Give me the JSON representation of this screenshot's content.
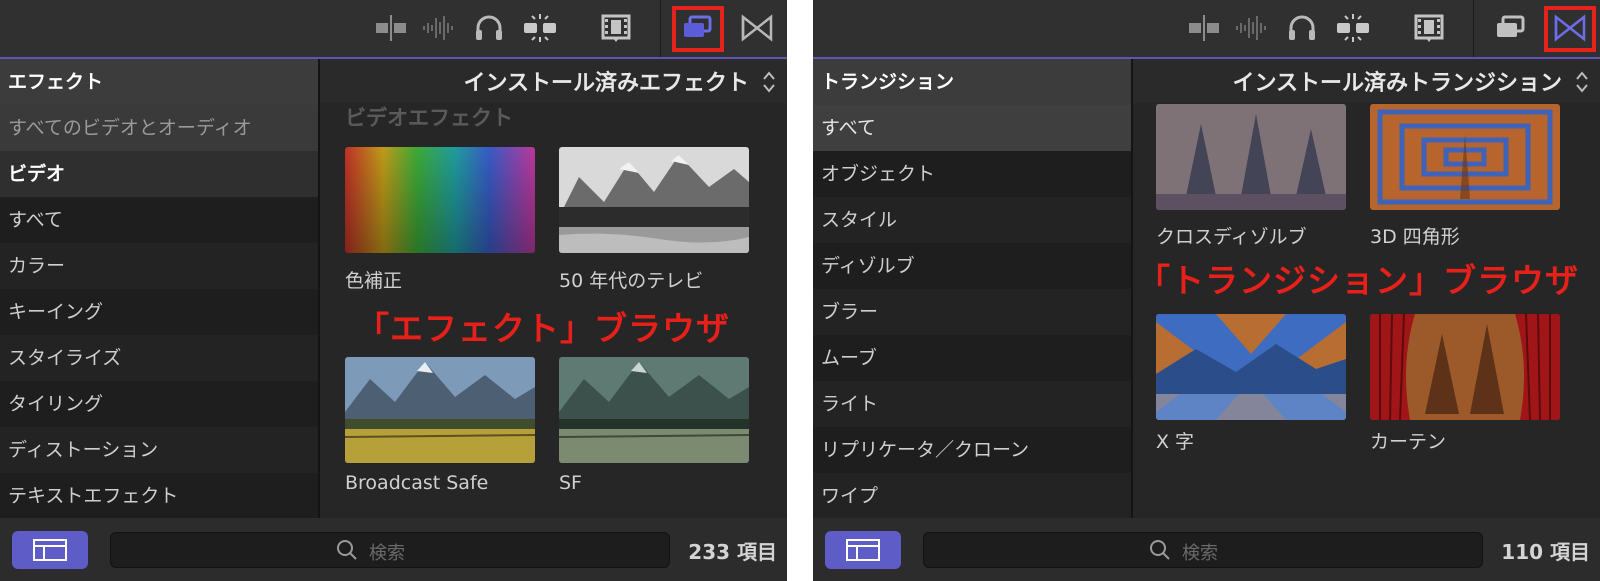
{
  "effects_browser": {
    "sidebar_header": "エフェクト",
    "sidebar_items": [
      {
        "label": "すべてのビデオとオーディオ"
      },
      {
        "label": "ビデオ"
      },
      {
        "label": "すべて"
      },
      {
        "label": "カラー"
      },
      {
        "label": "キーイング"
      },
      {
        "label": "スタイライズ"
      },
      {
        "label": "タイリング"
      },
      {
        "label": "ディストーション"
      },
      {
        "label": "テキストエフェクト"
      }
    ],
    "title": "インストール済みエフェクト",
    "section_label": "ビデオエフェクト",
    "items": [
      {
        "label": "色補正",
        "thumb": "rainbow-gradient"
      },
      {
        "label": "50 年代のテレビ",
        "thumb": "bw-mountains"
      },
      {
        "label": "Broadcast Safe",
        "thumb": "mountain-meadow"
      },
      {
        "label": "SF",
        "thumb": "green-tint-mountain"
      }
    ],
    "overlay_label": "「エフェクト」ブラウザ",
    "search_placeholder": "検索",
    "item_count": "233 項目"
  },
  "transitions_browser": {
    "sidebar_header": "トランジション",
    "sidebar_items": [
      {
        "label": "すべて"
      },
      {
        "label": "オブジェクト"
      },
      {
        "label": "スタイル"
      },
      {
        "label": "ディゾルブ"
      },
      {
        "label": "ブラー"
      },
      {
        "label": "ムーブ"
      },
      {
        "label": "ライト"
      },
      {
        "label": "リプリケータ／クローン"
      },
      {
        "label": "ワイプ"
      }
    ],
    "title": "インストール済みトランジション",
    "items": [
      {
        "label": "クロスディゾルブ",
        "thumb": "forest-dissolve"
      },
      {
        "label": "3D 四角形",
        "thumb": "concentric-squares"
      },
      {
        "label": "X 字",
        "thumb": "x-shape-mountains"
      },
      {
        "label": "カーテン",
        "thumb": "red-curtain-forest"
      }
    ],
    "overlay_label": "「トランジション」ブラウザ",
    "search_placeholder": "検索",
    "item_count": "110 項目"
  },
  "toolbar_icons": [
    "video-clip-icon",
    "audio-waveform-icon",
    "headphones-icon",
    "solo-split-icon",
    "filmstrip-icon",
    "effects-browser-icon",
    "transitions-browser-icon"
  ],
  "colors": {
    "highlight": "#e4231c",
    "accent": "#5e5cc6",
    "overlay_text": "#e8201a"
  }
}
